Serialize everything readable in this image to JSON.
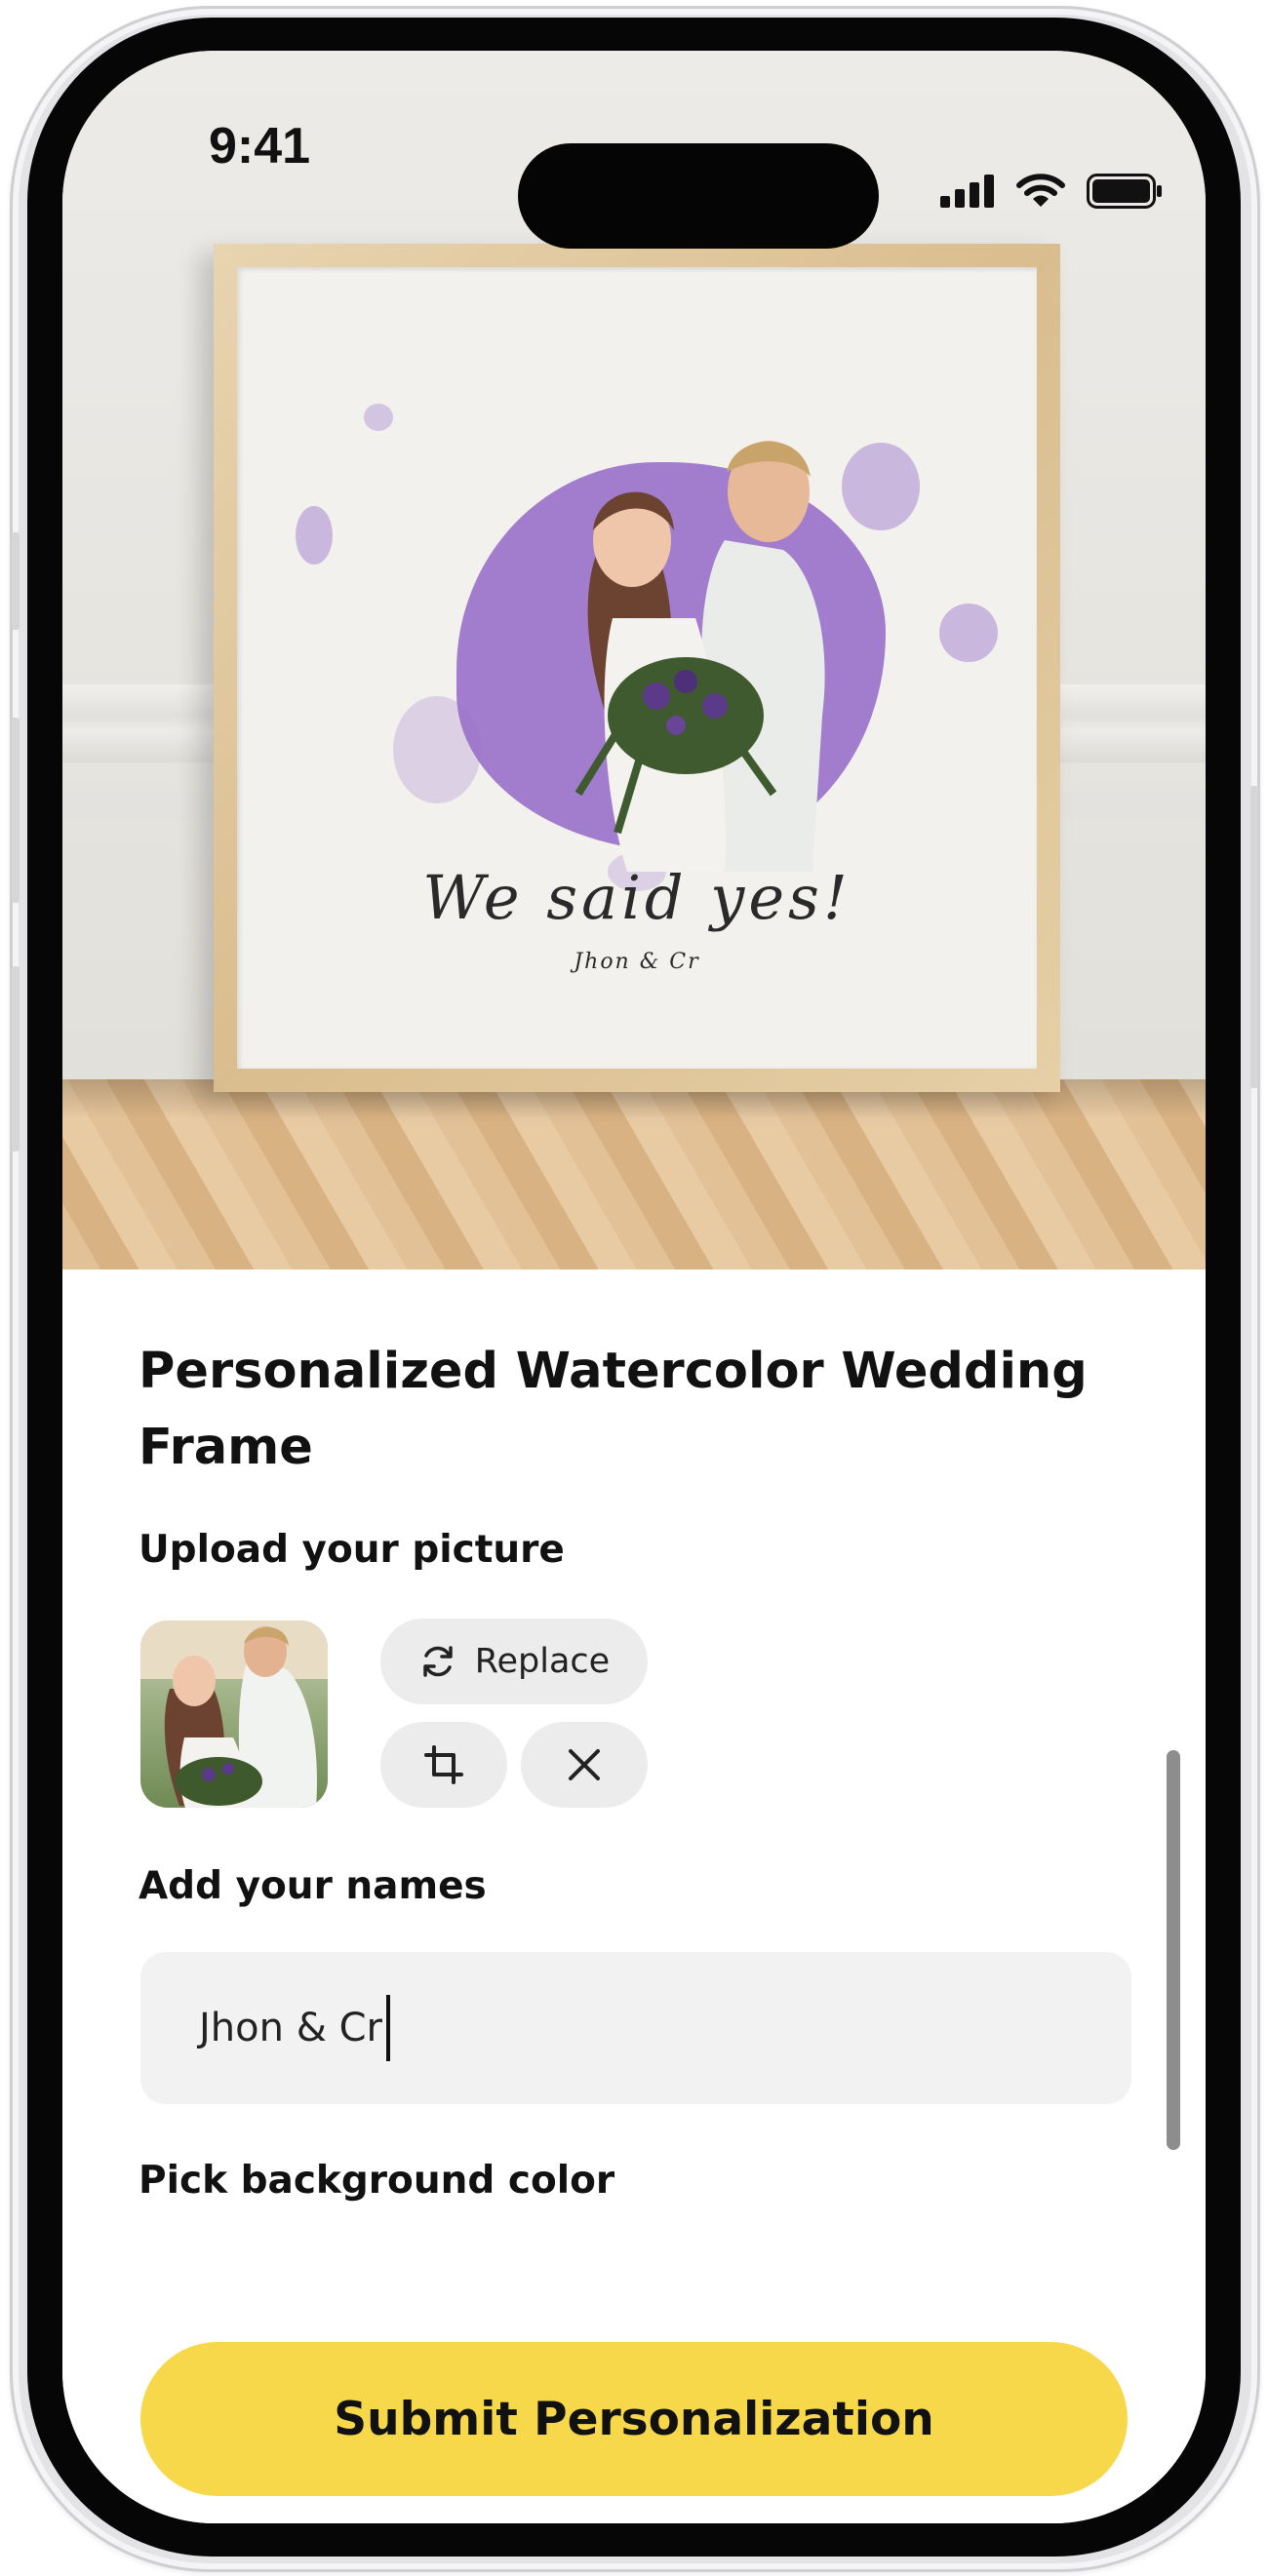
{
  "status_bar": {
    "time": "9:41",
    "icons": [
      "cellular-signal-icon",
      "wifi-icon",
      "battery-icon"
    ]
  },
  "preview": {
    "frame_title": "We said yes!",
    "frame_names": "Jhon & Cr",
    "blob_color": "#9a70c9"
  },
  "product": {
    "title": "Personalized Watercolor Wedding Frame"
  },
  "upload": {
    "label": "Upload your picture",
    "replace_label": "Replace",
    "actions": [
      "refresh-icon",
      "crop-icon",
      "close-icon"
    ]
  },
  "names": {
    "label": "Add your names",
    "value": "Jhon & Cr"
  },
  "background_color": {
    "label": "Pick background color"
  },
  "submit": {
    "label": "Submit Personalization"
  },
  "colors": {
    "accent": "#f7d84b",
    "pill": "#ececec",
    "input": "#f2f2f2",
    "text": "#111111"
  }
}
